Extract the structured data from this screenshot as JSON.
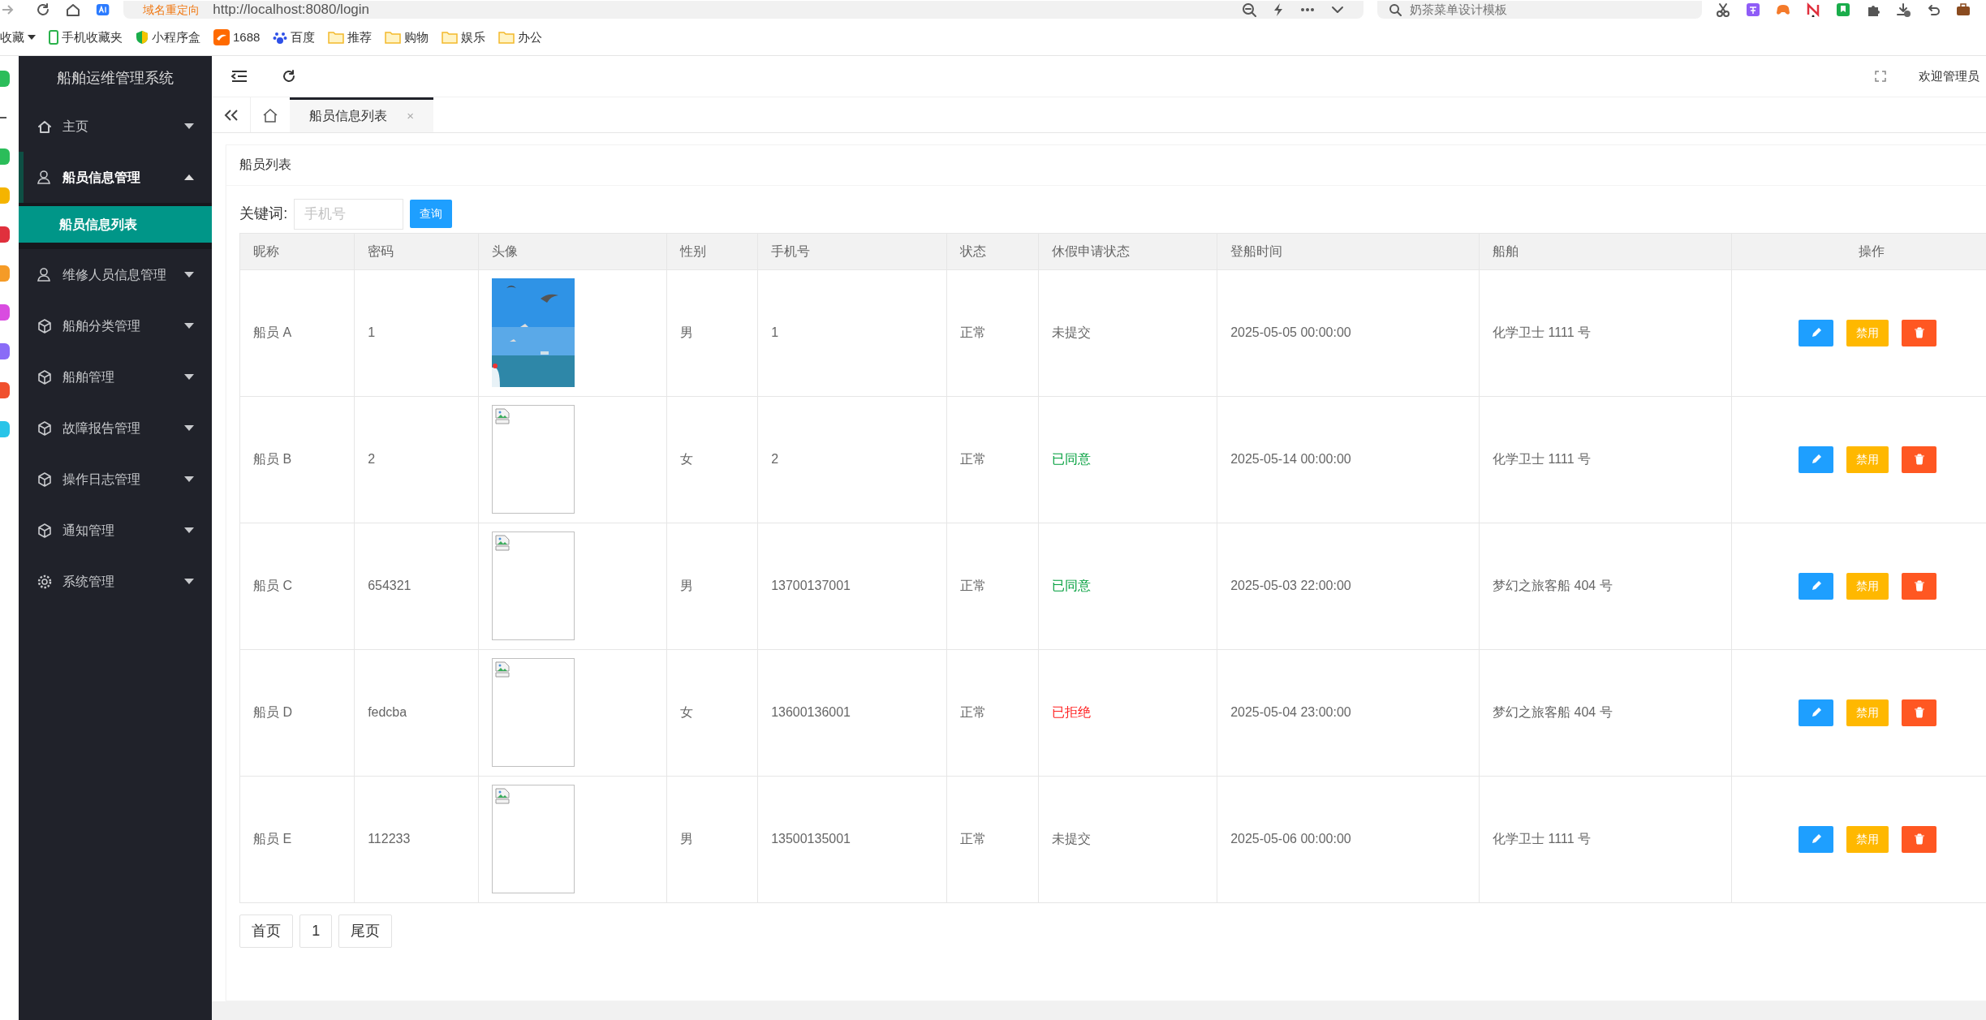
{
  "browser": {
    "redirect_label": "域名重定向",
    "url": "http://localhost:8080/login",
    "search_placeholder": "奶茶菜单设计模板"
  },
  "bookmarks": [
    {
      "label": "收藏",
      "kind": "menu"
    },
    {
      "label": "手机收藏夹",
      "kind": "phone"
    },
    {
      "label": "小程序盒",
      "kind": "shield"
    },
    {
      "label": "1688",
      "kind": "brand"
    },
    {
      "label": "百度",
      "kind": "paw"
    },
    {
      "label": "推荐",
      "kind": "folder"
    },
    {
      "label": "购物",
      "kind": "folder"
    },
    {
      "label": "娱乐",
      "kind": "folder"
    },
    {
      "label": "办公",
      "kind": "folder"
    }
  ],
  "app": {
    "title": "船舶运维管理系统"
  },
  "sidebar": {
    "items": [
      {
        "label": "主页",
        "kind": "home",
        "expanded": false
      },
      {
        "label": "船员信息管理",
        "kind": "user",
        "expanded": true,
        "children": [
          {
            "label": "船员信息列表",
            "selected": true
          }
        ]
      },
      {
        "label": "维修人员信息管理",
        "kind": "user",
        "expanded": false
      },
      {
        "label": "船舶分类管理",
        "kind": "cube",
        "expanded": false
      },
      {
        "label": "船舶管理",
        "kind": "cube",
        "expanded": false
      },
      {
        "label": "故障报告管理",
        "kind": "cube",
        "expanded": false
      },
      {
        "label": "操作日志管理",
        "kind": "cube",
        "expanded": false
      },
      {
        "label": "通知管理",
        "kind": "cube",
        "expanded": false
      },
      {
        "label": "系统管理",
        "kind": "gear",
        "expanded": false
      }
    ]
  },
  "header": {
    "welcome": "欢迎管理员"
  },
  "tabs": [
    {
      "label": "船员信息列表",
      "close": "×",
      "selected": true
    }
  ],
  "card": {
    "title": "船员列表"
  },
  "search": {
    "label": "关键词:",
    "placeholder": "手机号",
    "button": "查询"
  },
  "table": {
    "columns": [
      "昵称",
      "密码",
      "头像",
      "性别",
      "手机号",
      "状态",
      "休假申请状态",
      "登船时间",
      "船舶",
      "操作"
    ],
    "rows": [
      {
        "nickname": "船员 A",
        "password": "1",
        "gender": "男",
        "phone": "1",
        "status": "正常",
        "leave": {
          "text": "未提交",
          "color": "#666666"
        },
        "boarding_time": "2025-05-05 00:00:00",
        "ship": "化学卫士 1111 号",
        "disable_label": "禁用"
      },
      {
        "nickname": "船员 B",
        "password": "2",
        "avatar": {
          "kind": "broken"
        },
        "gender": "女",
        "phone": "2",
        "status": "正常",
        "leave": {
          "text": "已同意",
          "color": "#009f3c"
        },
        "boarding_time": "2025-05-14 00:00:00",
        "ship": "化学卫士 1111 号",
        "disable_label": "禁用"
      },
      {
        "nickname": "船员 C",
        "password": "654321",
        "avatar": {
          "kind": "broken"
        },
        "gender": "男",
        "phone": "13700137001",
        "status": "正常",
        "leave": {
          "text": "已同意",
          "color": "#009f3c"
        },
        "boarding_time": "2025-05-03 22:00:00",
        "ship": "梦幻之旅客船 404 号",
        "disable_label": "禁用"
      },
      {
        "nickname": "船员 D",
        "password": "fedcba",
        "avatar": {
          "kind": "broken"
        },
        "gender": "女",
        "phone": "13600136001",
        "status": "正常",
        "leave": {
          "text": "已拒绝",
          "color": "#ff1f1f"
        },
        "boarding_time": "2025-05-04 23:00:00",
        "ship": "梦幻之旅客船 404 号",
        "disable_label": "禁用"
      },
      {
        "nickname": "船员 E",
        "password": "112233",
        "avatar": {
          "kind": "broken"
        },
        "gender": "男",
        "phone": "13500135001",
        "status": "正常",
        "leave": {
          "text": "未提交",
          "color": "#666666"
        },
        "boarding_time": "2025-05-06 00:00:00",
        "ship": "化学卫士 1111 号",
        "disable_label": "禁用"
      }
    ]
  },
  "pagination": [
    {
      "label": "首页"
    },
    {
      "label": "1"
    },
    {
      "label": "尾页"
    }
  ]
}
